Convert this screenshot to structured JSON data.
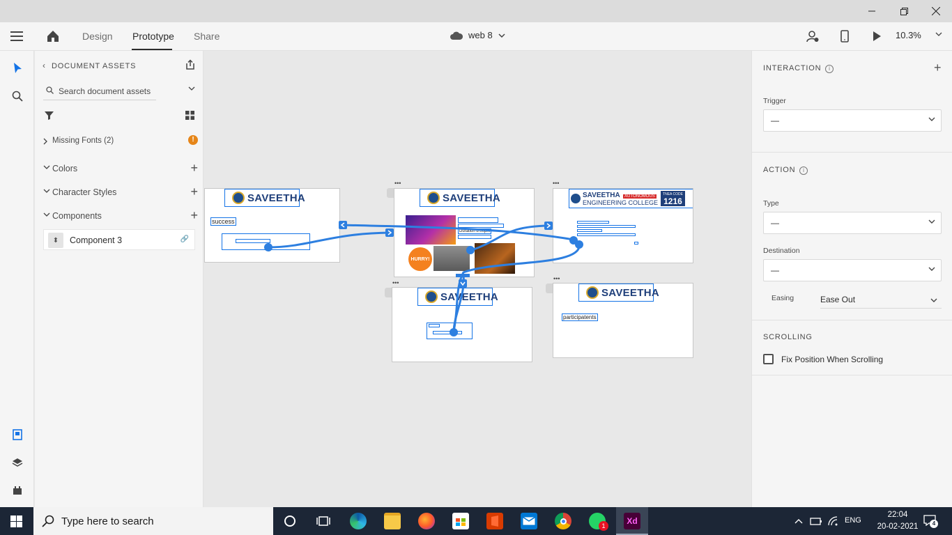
{
  "header": {
    "tabs": {
      "design": "Design",
      "prototype": "Prototype",
      "share": "Share"
    },
    "doc_title": "web 8",
    "zoom": "10.3%"
  },
  "assets": {
    "title": "DOCUMENT ASSETS",
    "search_placeholder": "Search document assets",
    "missing_fonts": "Missing Fonts (2)",
    "colors": "Colors",
    "character_styles": "Character Styles",
    "components": "Components",
    "component_item": "Component 3"
  },
  "canvas": {
    "logo_text": "SAVEETHA",
    "college_text": "SAVEETHA",
    "college_badge": "AUTONOMOUS",
    "college_sub": "ENGINEERING COLLEGE",
    "tnea_label": "TNEA CODE",
    "tnea_code": "1216",
    "success_text": "success",
    "participants_text": "participatents",
    "hurry_text": "HURRY!",
    "duration_text": "Duration 8:00pm"
  },
  "props": {
    "interaction": "INTERACTION",
    "trigger_label": "Trigger",
    "trigger_value": "—",
    "action": "ACTION",
    "type_label": "Type",
    "type_value": "—",
    "destination_label": "Destination",
    "destination_value": "—",
    "easing_label": "Easing",
    "easing_value": "Ease Out",
    "scrolling": "SCROLLING",
    "fix_position": "Fix Position When Scrolling"
  },
  "taskbar": {
    "search_placeholder": "Type here to search",
    "language": "ENG",
    "time": "22:04",
    "date": "20-02-2021",
    "notifications": "4",
    "whatsapp_badge": "1"
  },
  "colors": {
    "accent": "#1473e6",
    "wire": "#2d7fe0",
    "xd": "#470137",
    "xd_text": "#ff61f6"
  }
}
